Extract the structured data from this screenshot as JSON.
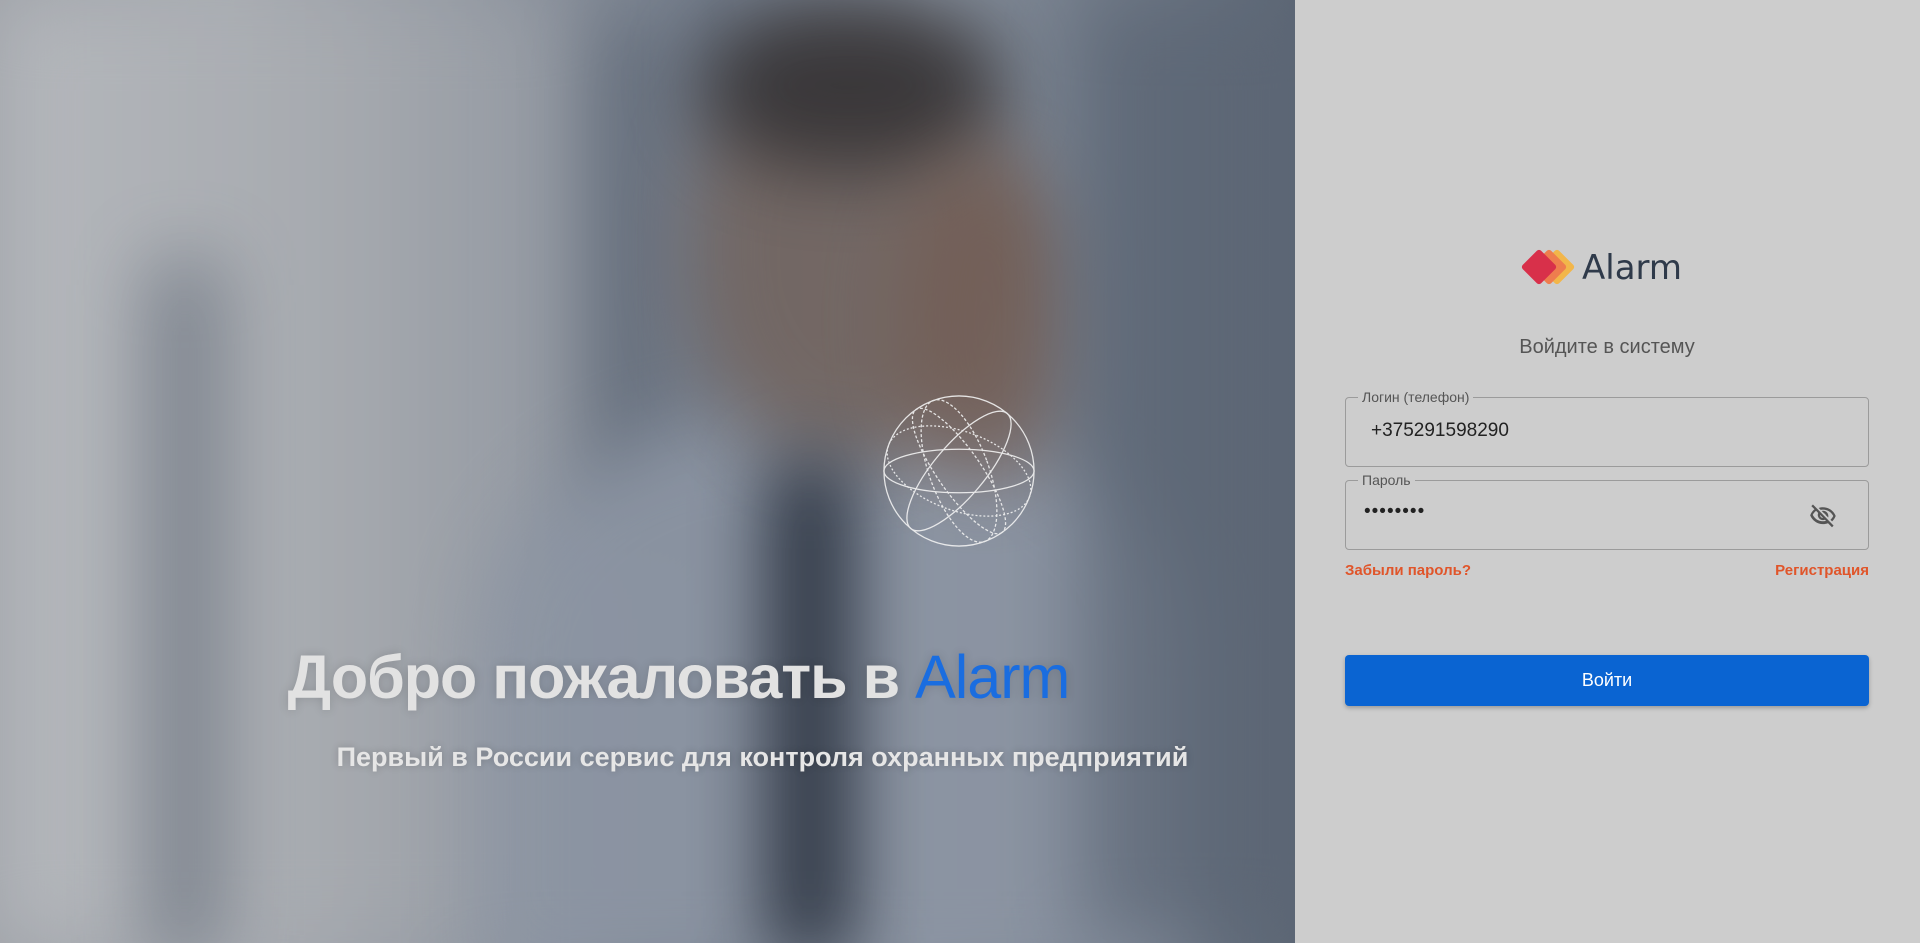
{
  "hero": {
    "welcome_text": "Добро пожаловать в ",
    "welcome_brand": "Alarm",
    "tagline": "Первый в России сервис для контроля охранных предприятий"
  },
  "login": {
    "logo_text": "Alarm",
    "subtitle": "Войдите в систему",
    "login_label": "Логин (телефон)",
    "login_value": "+375291598290",
    "password_label": "Пароль",
    "password_value": "••••••••",
    "forgot_link": "Забыли пароль?",
    "register_link": "Регистрация",
    "submit_label": "Войти"
  },
  "colors": {
    "accent": "#0a64d2",
    "link": "#e0552a",
    "brand": "#1a6de0"
  },
  "icons": {
    "password_toggle": "eye-off-icon",
    "logo_mark": "alarm-logo-icon",
    "globe": "globe-icon"
  }
}
